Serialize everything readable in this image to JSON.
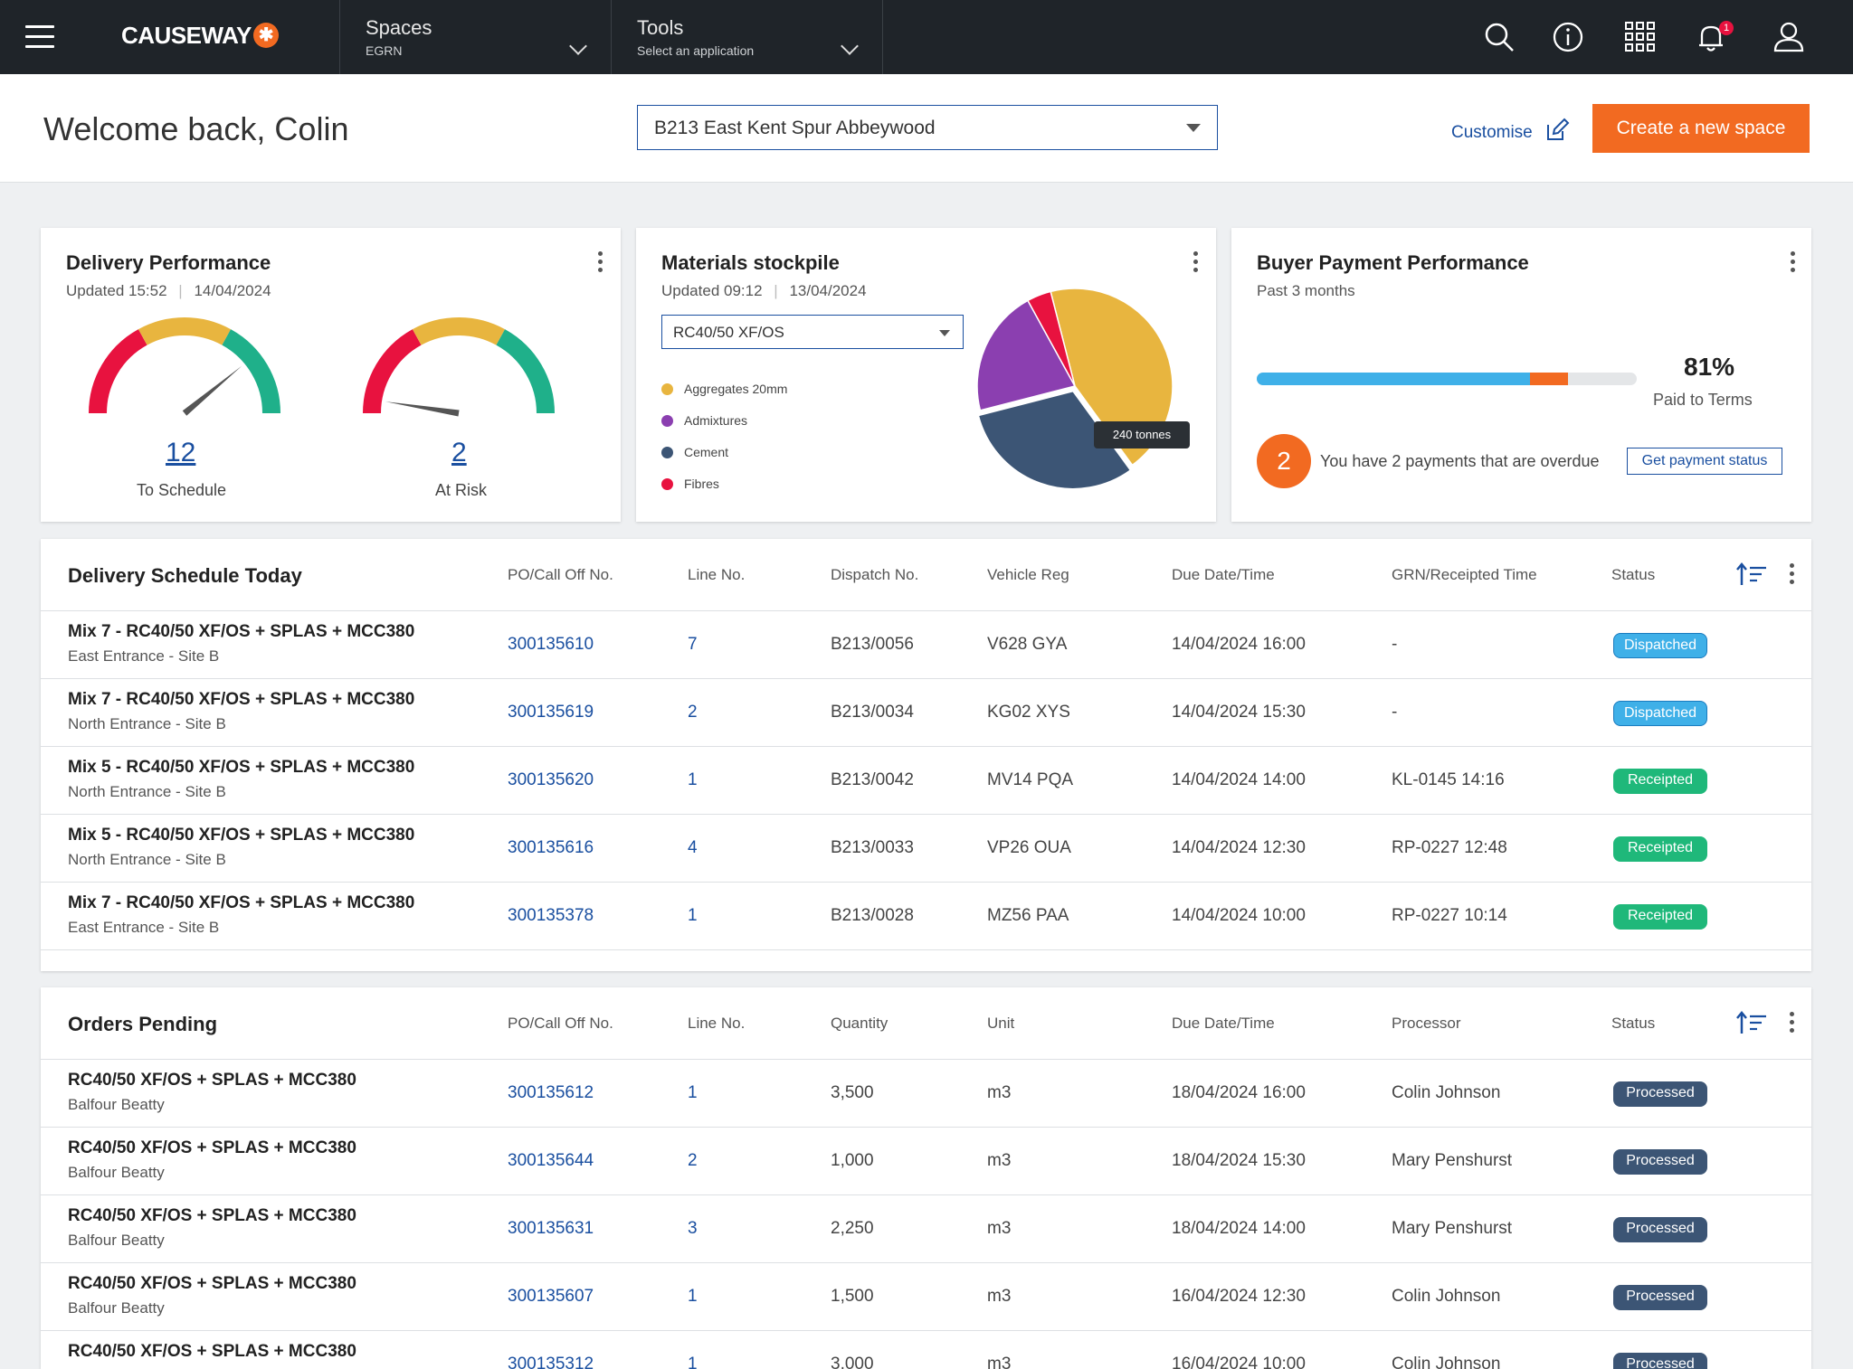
{
  "topbar": {
    "logo_text": "CAUSEWAY",
    "logo_mark": "✱",
    "spaces": {
      "title": "Spaces",
      "subtitle": "EGRN"
    },
    "tools": {
      "title": "Tools",
      "subtitle": "Select an application"
    },
    "notification_badge": "1",
    "icons": [
      "menu-icon",
      "search-icon",
      "info-icon",
      "apps-grid-icon",
      "bell-icon",
      "user-icon"
    ]
  },
  "header": {
    "welcome": "Welcome back, Colin",
    "space_select": "B213 East Kent Spur Abbeywood",
    "customise": "Customise",
    "create_button": "Create a new space"
  },
  "delivery_performance": {
    "title": "Delivery Performance",
    "updated_time": "Updated 15:52",
    "updated_date": "14/04/2024",
    "gauges": [
      {
        "value": "12",
        "label": "To Schedule",
        "needle_fraction": 0.78
      },
      {
        "value": "2",
        "label": "At Risk",
        "needle_fraction": 0.05
      }
    ]
  },
  "materials": {
    "title": "Materials stockpile",
    "updated_time": "Updated 09:12",
    "updated_date": "13/04/2024",
    "select": "RC40/50 XF/OS",
    "legend": [
      {
        "label": "Aggregates 20mm",
        "color": "#e8b53f"
      },
      {
        "label": "Admixtures",
        "color": "#8b3fb0"
      },
      {
        "label": "Cement",
        "color": "#3c5575"
      },
      {
        "label": "Fibres",
        "color": "#e8123f"
      }
    ],
    "tooltip": "240 tonnes"
  },
  "chart_data": {
    "type": "pie",
    "categories": [
      "Aggregates 20mm",
      "Cement",
      "Admixtures",
      "Fibres"
    ],
    "values": [
      44,
      31,
      21,
      4
    ],
    "colors": [
      "#e8b53f",
      "#3c5575",
      "#8b3fb0",
      "#e8123f"
    ]
  },
  "payment": {
    "title": "Buyer Payment Performance",
    "subtitle": "Past 3 months",
    "progress_blue": 0.72,
    "progress_orange": 0.1,
    "percent": "81%",
    "paid_label": "Paid to Terms",
    "overdue_count": "2",
    "overdue_text": "You have 2 payments that are overdue",
    "button": "Get payment status"
  },
  "delivery_schedule": {
    "title": "Delivery Schedule Today",
    "headers": [
      "PO/Call Off No.",
      "Line No.",
      "Dispatch No.",
      "Vehicle Reg",
      "Due Date/Time",
      "GRN/Receipted Time",
      "Status"
    ],
    "rows": [
      {
        "desc": "Mix 7 - RC40/50 XF/OS + SPLAS + MCC380",
        "loc": "East Entrance - Site B",
        "po": "300135610",
        "line": "7",
        "dispatch": "B213/0056",
        "reg": "V628 GYA",
        "due": "14/04/2024  16:00",
        "grn": "-",
        "status": "Dispatched"
      },
      {
        "desc": "Mix 7 - RC40/50 XF/OS + SPLAS + MCC380",
        "loc": "North Entrance - Site B",
        "po": "300135619",
        "line": "2",
        "dispatch": "B213/0034",
        "reg": "KG02 XYS",
        "due": "14/04/2024  15:30",
        "grn": "-",
        "status": "Dispatched"
      },
      {
        "desc": "Mix 5 - RC40/50 XF/OS + SPLAS + MCC380",
        "loc": "North Entrance - Site B",
        "po": "300135620",
        "line": "1",
        "dispatch": "B213/0042",
        "reg": "MV14 PQA",
        "due": "14/04/2024  14:00",
        "grn": "KL-0145  14:16",
        "status": "Receipted"
      },
      {
        "desc": "Mix 5 - RC40/50 XF/OS + SPLAS + MCC380",
        "loc": "North Entrance - Site B",
        "po": "300135616",
        "line": "4",
        "dispatch": "B213/0033",
        "reg": "VP26 OUA",
        "due": "14/04/2024  12:30",
        "grn": "RP-0227  12:48",
        "status": "Receipted"
      },
      {
        "desc": "Mix 7 - RC40/50 XF/OS + SPLAS + MCC380",
        "loc": "East Entrance - Site B",
        "po": "300135378",
        "line": "1",
        "dispatch": "B213/0028",
        "reg": "MZ56 PAA",
        "due": "14/04/2024  10:00",
        "grn": "RP-0227  10:14",
        "status": "Receipted"
      }
    ]
  },
  "orders_pending": {
    "title": "Orders Pending",
    "headers": [
      "PO/Call Off No.",
      "Line No.",
      "Quantity",
      "Unit",
      "Due Date/Time",
      "Processor",
      "Status"
    ],
    "rows": [
      {
        "desc": "RC40/50 XF/OS + SPLAS + MCC380",
        "loc": "Balfour Beatty",
        "po": "300135612",
        "line": "1",
        "qty": "3,500",
        "unit": "m3",
        "due": "18/04/2024  16:00",
        "processor": "Colin Johnson",
        "status": "Processed"
      },
      {
        "desc": "RC40/50 XF/OS + SPLAS + MCC380",
        "loc": "Balfour Beatty",
        "po": "300135644",
        "line": "2",
        "qty": "1,000",
        "unit": "m3",
        "due": "18/04/2024  15:30",
        "processor": "Mary Penshurst",
        "status": "Processed"
      },
      {
        "desc": "RC40/50 XF/OS + SPLAS + MCC380",
        "loc": "Balfour Beatty",
        "po": "300135631",
        "line": "3",
        "qty": "2,250",
        "unit": "m3",
        "due": "18/04/2024  14:00",
        "processor": "Mary Penshurst",
        "status": "Processed"
      },
      {
        "desc": "RC40/50 XF/OS + SPLAS + MCC380",
        "loc": "Balfour Beatty",
        "po": "300135607",
        "line": "1",
        "qty": "1,500",
        "unit": "m3",
        "due": "16/04/2024  12:30",
        "processor": "Colin Johnson",
        "status": "Processed"
      },
      {
        "desc": "RC40/50 XF/OS + SPLAS + MCC380",
        "loc": "",
        "po": "300135312",
        "line": "1",
        "qty": "3,000",
        "unit": "m3",
        "due": "16/04/2024  10:00",
        "processor": "Colin Johnson",
        "status": "Processed"
      }
    ]
  }
}
